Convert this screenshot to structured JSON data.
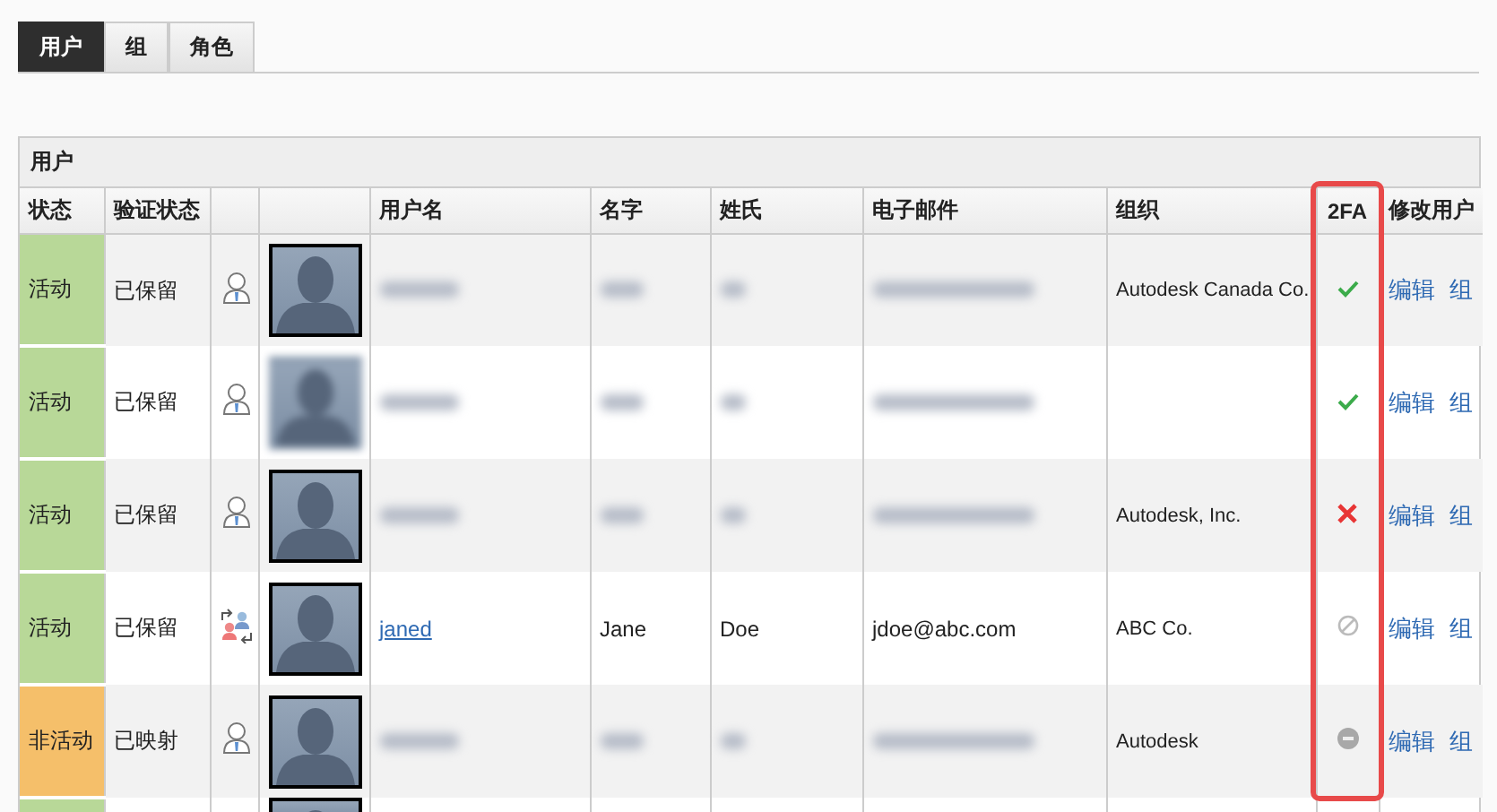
{
  "tabs": [
    {
      "label": "用户",
      "selected": true
    },
    {
      "label": "组",
      "selected": false
    },
    {
      "label": "角色",
      "selected": false
    }
  ],
  "panel": {
    "title": "用户",
    "columns": [
      "状态",
      "验证状态",
      "",
      "",
      "用户名",
      "名字",
      "姓氏",
      "电子邮件",
      "组织",
      "2FA",
      "修改用户"
    ],
    "rows": [
      {
        "status": "活动",
        "color": "#b8d898",
        "verify": "已保留",
        "kind": "local",
        "photo": {
          "kind": "plain"
        },
        "redacted": true,
        "org": "Autodesk Canada Co.",
        "twofa": {
          "kind": "enabled"
        },
        "actions": [
          "编辑",
          "组"
        ]
      },
      {
        "status": "活动",
        "color": "#b8d898",
        "verify": "已保留",
        "kind": "local",
        "photo": {
          "kind": "blurred"
        },
        "redacted": true,
        "twofa": {
          "kind": "enabled"
        },
        "actions": [
          "编辑",
          "组"
        ]
      },
      {
        "status": "活动",
        "color": "#b8d898",
        "verify": "已保留",
        "kind": "local",
        "photo": {
          "kind": "plain"
        },
        "redacted": true,
        "org": "Autodesk, Inc.",
        "twofa": {
          "kind": "disabled"
        },
        "actions": [
          "编辑",
          "组"
        ]
      },
      {
        "status": "活动",
        "color": "#b8d898",
        "verify": "已保留",
        "kind": "federated",
        "photo": {
          "kind": "plain"
        },
        "redacted": false,
        "username": "janed",
        "first": "Jane",
        "last": "Doe",
        "email": "jdoe@abc.com",
        "org": "ABC Co.",
        "twofa": {
          "kind": "not_applicable"
        },
        "actions": [
          "编辑",
          "组"
        ]
      },
      {
        "status": "非活动",
        "color": "#f5bf6a",
        "verify": "已映射",
        "kind": "local",
        "photo": {
          "kind": "plain"
        },
        "redacted": true,
        "org": "Autodesk",
        "twofa": {
          "kind": "unknown"
        },
        "actions": [
          "编辑",
          "组"
        ]
      },
      {
        "color": "#b8d898",
        "photo": {
          "kind": "plain"
        },
        "partial": true
      }
    ]
  }
}
